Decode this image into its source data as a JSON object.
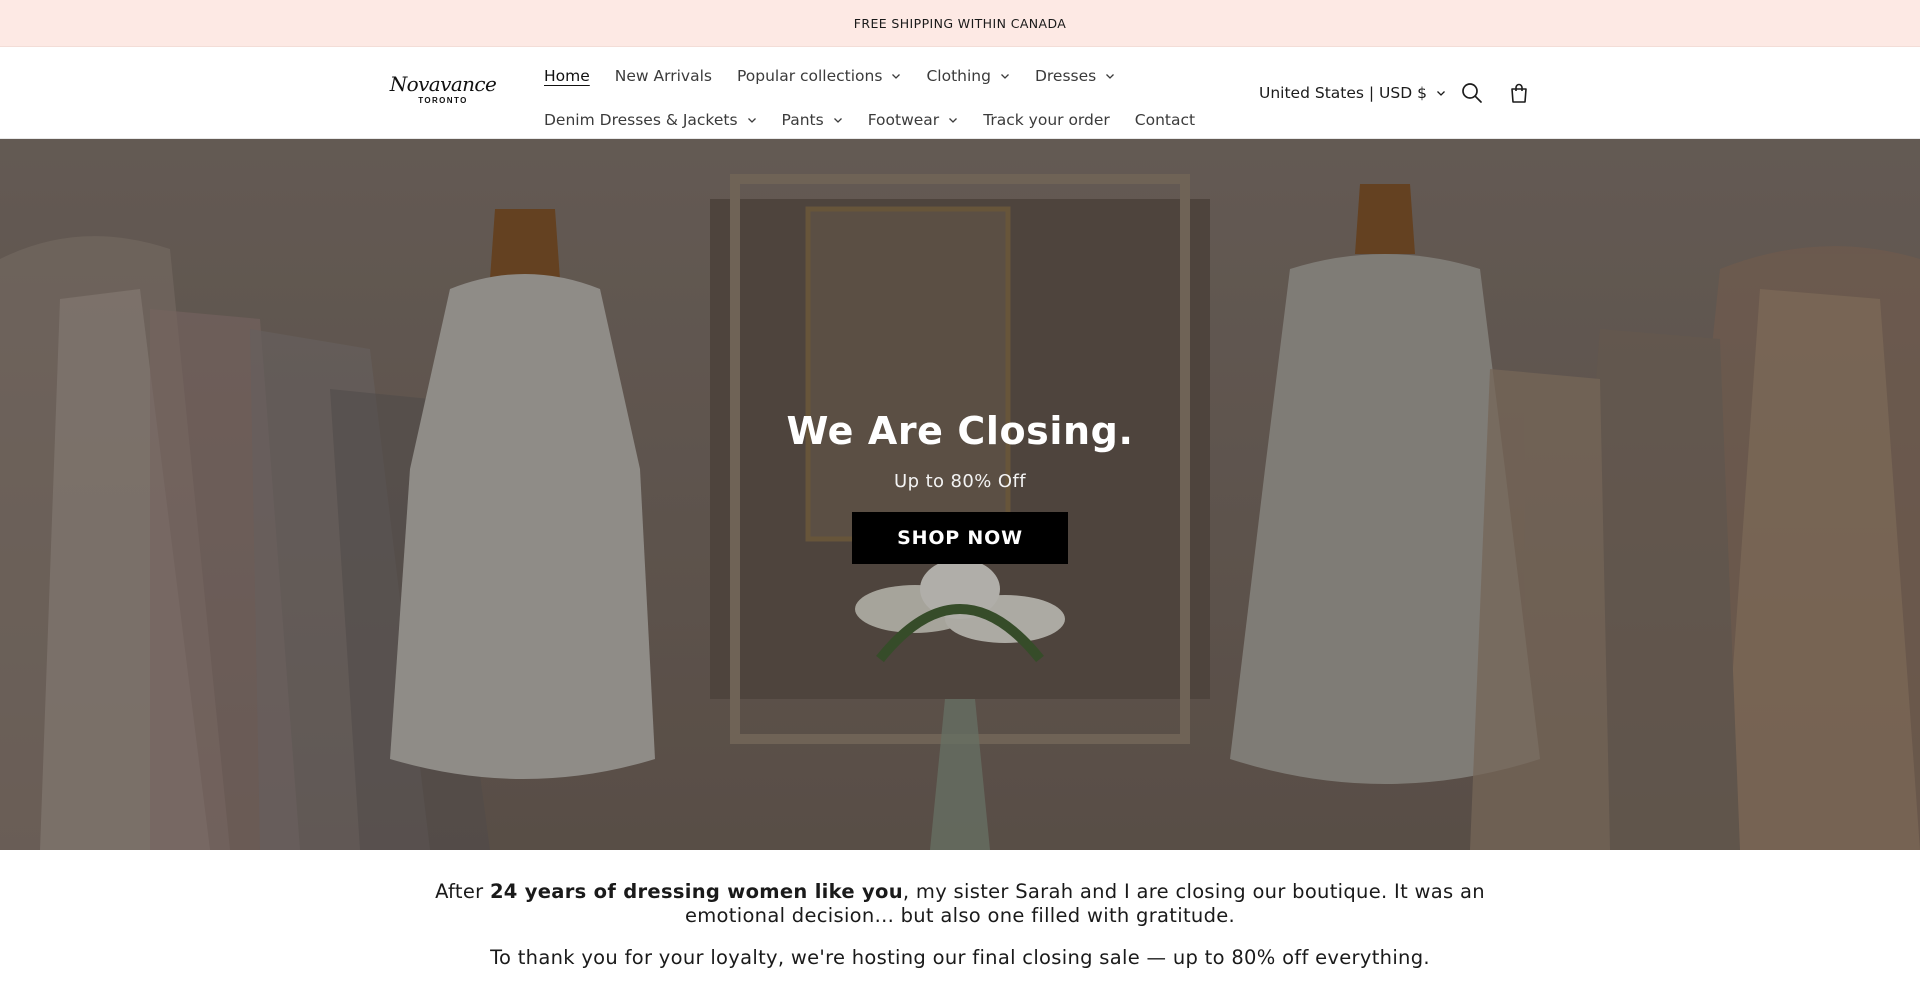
{
  "announcement": {
    "text": "FREE SHIPPING WITHIN CANADA"
  },
  "brand": {
    "name": "Novavance",
    "city": "TORONTO"
  },
  "nav": {
    "row1": [
      {
        "label": "Home",
        "active": true,
        "dropdown": false
      },
      {
        "label": "New Arrivals",
        "dropdown": false
      },
      {
        "label": "Popular collections",
        "dropdown": true
      },
      {
        "label": "Clothing",
        "dropdown": true
      },
      {
        "label": "Dresses",
        "dropdown": true
      }
    ],
    "row2": [
      {
        "label": "Denim Dresses & Jackets",
        "dropdown": true
      },
      {
        "label": "Pants",
        "dropdown": true
      },
      {
        "label": "Footwear",
        "dropdown": true
      },
      {
        "label": "Track your order",
        "dropdown": false
      },
      {
        "label": "Contact",
        "dropdown": false
      }
    ]
  },
  "locale": {
    "label": "United States | USD $"
  },
  "icons": {
    "search": "search-icon",
    "cart": "cart-icon",
    "chevron": "chevron-down-icon"
  },
  "hero": {
    "title": "We Are Closing.",
    "subtitle": "Up to 80% Off",
    "cta": "SHOP NOW"
  },
  "intro": {
    "p1_before": "After ",
    "p1_bold": "24 years of dressing women like you",
    "p1_after": ", my sister Sarah and I are closing our boutique. It was an emotional decision... but also one filled with gratitude.",
    "p2": "To thank you for your loyalty, we're hosting our final closing sale — up to 80% off everything."
  },
  "colors": {
    "announcement_bg": "#fde9e4",
    "cta_bg": "#000000",
    "text": "#121212"
  }
}
